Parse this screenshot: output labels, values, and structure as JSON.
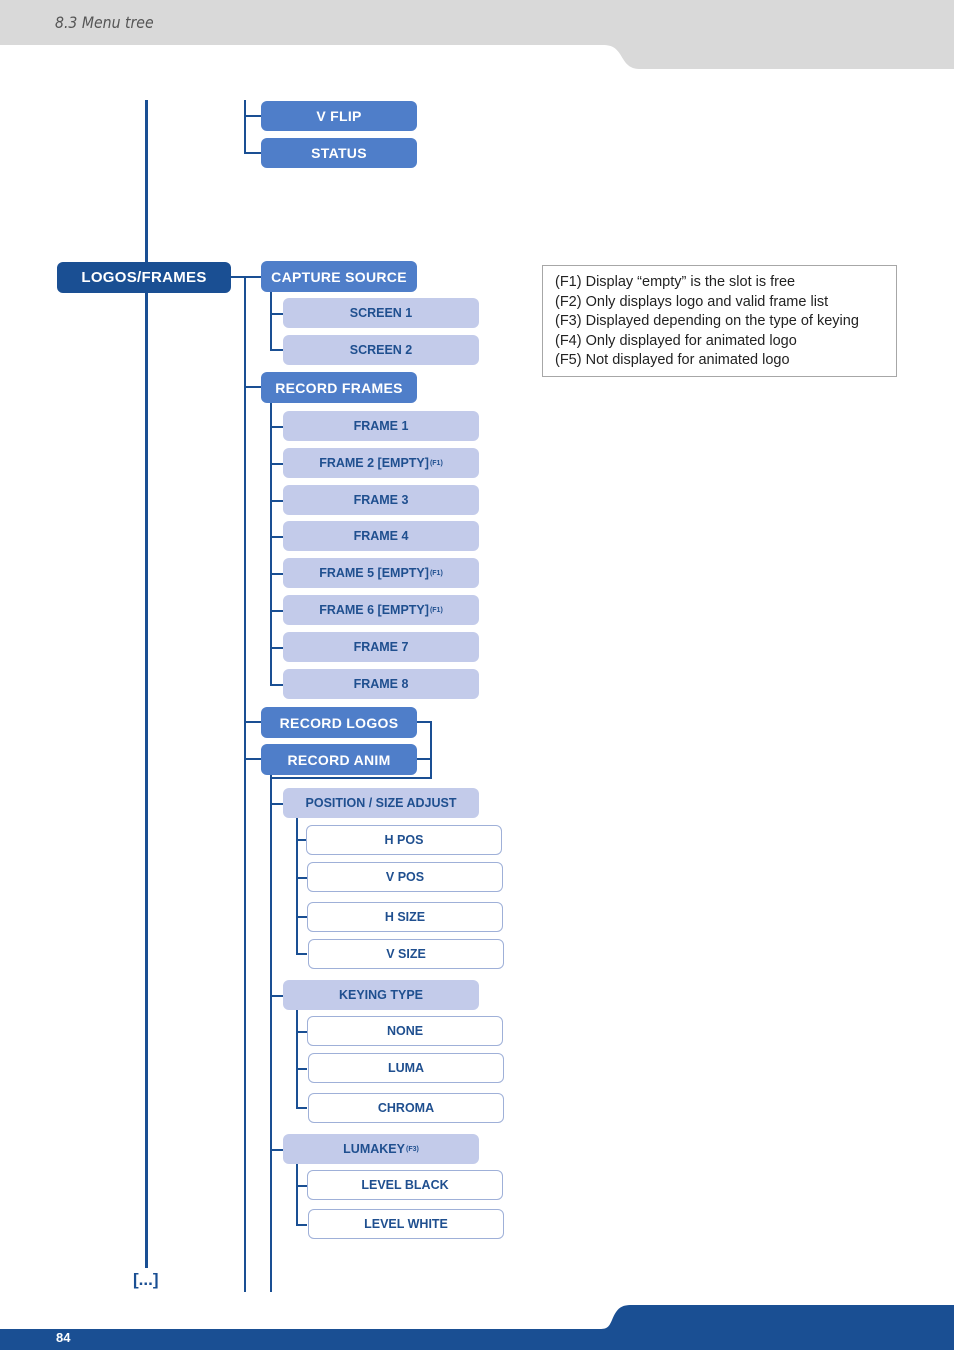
{
  "header": {
    "section_title": "8.3 Menu tree"
  },
  "footer": {
    "page_number": "84"
  },
  "colors": {
    "dark_blue": "#1a4f93",
    "mid_blue": "#4f7ec9",
    "light_blue": "#c3cbea",
    "header_gray": "#d9d9d9"
  },
  "tree": {
    "top_items": [
      {
        "label": "V FLIP"
      },
      {
        "label": "STATUS"
      }
    ],
    "root": {
      "label": "LOGOS/FRAMES"
    },
    "capture_source": {
      "label": "CAPTURE SOURCE",
      "children": [
        {
          "label": "SCREEN 1"
        },
        {
          "label": "SCREEN 2"
        }
      ]
    },
    "record_frames": {
      "label": "RECORD FRAMES",
      "children": [
        {
          "label": "FRAME 1",
          "note": ""
        },
        {
          "label": "FRAME 2 [EMPTY]",
          "note": "(F1)"
        },
        {
          "label": "FRAME 3",
          "note": ""
        },
        {
          "label": "FRAME 4",
          "note": ""
        },
        {
          "label": "FRAME 5 [EMPTY]",
          "note": "(F1)"
        },
        {
          "label": "FRAME 6 [EMPTY]",
          "note": "(F1)"
        },
        {
          "label": "FRAME 7",
          "note": ""
        },
        {
          "label": "FRAME 8",
          "note": ""
        }
      ]
    },
    "record_logos": {
      "label": "RECORD LOGOS"
    },
    "record_anim": {
      "label": "RECORD ANIM"
    },
    "position_size": {
      "label": "POSITION / SIZE ADJUST",
      "children": [
        {
          "label": "H POS"
        },
        {
          "label": "V POS"
        },
        {
          "label": "H SIZE"
        },
        {
          "label": "V SIZE"
        }
      ]
    },
    "keying_type": {
      "label": "KEYING TYPE",
      "children": [
        {
          "label": "NONE"
        },
        {
          "label": "LUMA"
        },
        {
          "label": "CHROMA"
        }
      ]
    },
    "lumakey": {
      "label": "LUMAKEY",
      "note": "(F3)",
      "children": [
        {
          "label": "LEVEL BLACK"
        },
        {
          "label": "LEVEL WHITE"
        }
      ]
    },
    "continuation": "[...]"
  },
  "notes": [
    "(F1) Display “empty” is the slot is free",
    "(F2) Only displays logo and valid frame list",
    "(F3) Displayed depending on the type of keying",
    "(F4) Only displayed for animated logo",
    "(F5) Not displayed for animated logo"
  ]
}
